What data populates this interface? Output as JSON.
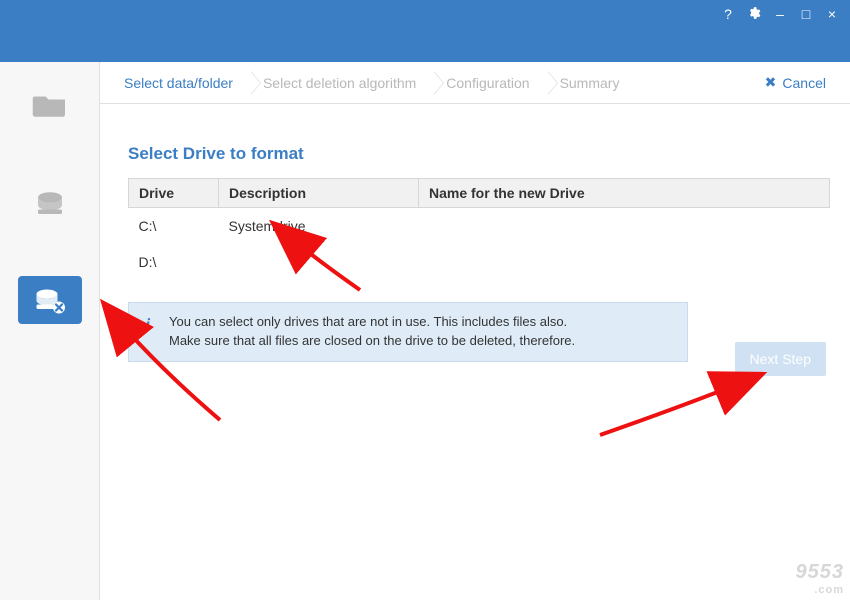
{
  "colors": {
    "accent": "#3b7ec4",
    "muted": "#b8b8b8",
    "info_bg": "#dfecf7"
  },
  "titlebar": {
    "help_icon": "?",
    "settings_icon": "gear",
    "minimize_icon": "–",
    "maximize_icon": "□",
    "close_icon": "×"
  },
  "sidebar": {
    "items": [
      {
        "name": "files-folder",
        "icon": "folder-icon",
        "active": false
      },
      {
        "name": "drive",
        "icon": "drive-icon",
        "active": false
      },
      {
        "name": "drive-delete",
        "icon": "drive-x-icon",
        "active": true
      }
    ]
  },
  "breadcrumb": {
    "steps": [
      {
        "label": "Select data/folder",
        "active": true
      },
      {
        "label": "Select deletion algorithm",
        "active": false
      },
      {
        "label": "Configuration",
        "active": false
      },
      {
        "label": "Summary",
        "active": false
      }
    ],
    "cancel_icon": "✖",
    "cancel_label": "Cancel"
  },
  "page": {
    "title": "Select Drive to format",
    "table": {
      "headers": [
        "Drive",
        "Description",
        "Name for the new Drive"
      ],
      "rows": [
        {
          "drive": "C:\\",
          "description": "Systemdrive",
          "new_name": ""
        },
        {
          "drive": "D:\\",
          "description": "",
          "new_name": ""
        }
      ]
    },
    "info": {
      "icon_label": "i",
      "line1": "You can select only drives that are not in use. This includes files also.",
      "line2": "Make sure that all files are closed on the drive to be deleted, therefore."
    },
    "next_button": "Next Step"
  },
  "watermark": {
    "text": "9553",
    "sub": ".com"
  }
}
